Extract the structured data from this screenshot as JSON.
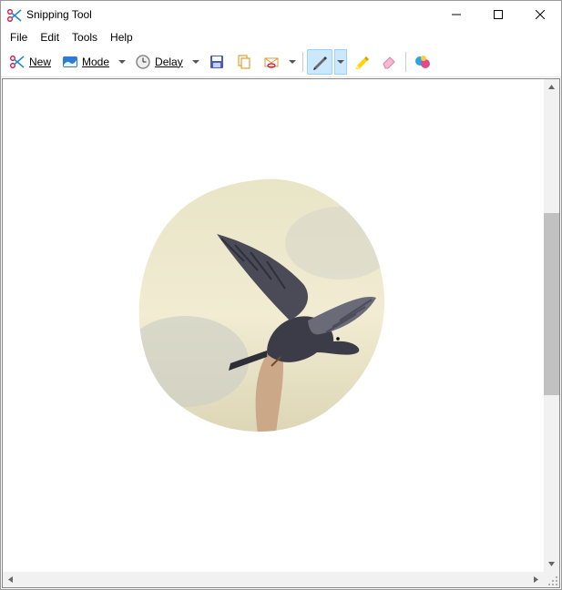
{
  "titlebar": {
    "title": "Snipping Tool"
  },
  "menubar": {
    "file": "File",
    "edit": "Edit",
    "tools": "Tools",
    "help": "Help"
  },
  "toolbar": {
    "new_label": "New",
    "mode_label": "Mode",
    "delay_label": "Delay"
  },
  "icons": {
    "app": "scissors-icon",
    "new": "scissors-icon",
    "mode": "rectangle-mode-icon",
    "delay": "clock-icon",
    "save": "save-icon",
    "copy": "copy-icon",
    "send": "send-mail-icon",
    "pen": "pen-icon",
    "highlighter": "highlighter-icon",
    "eraser": "eraser-icon",
    "paint3d": "paint-3d-icon"
  },
  "canvas": {
    "content_description": "free-form snip of a pigeon taking flight from a fingertip against a pale sky"
  }
}
